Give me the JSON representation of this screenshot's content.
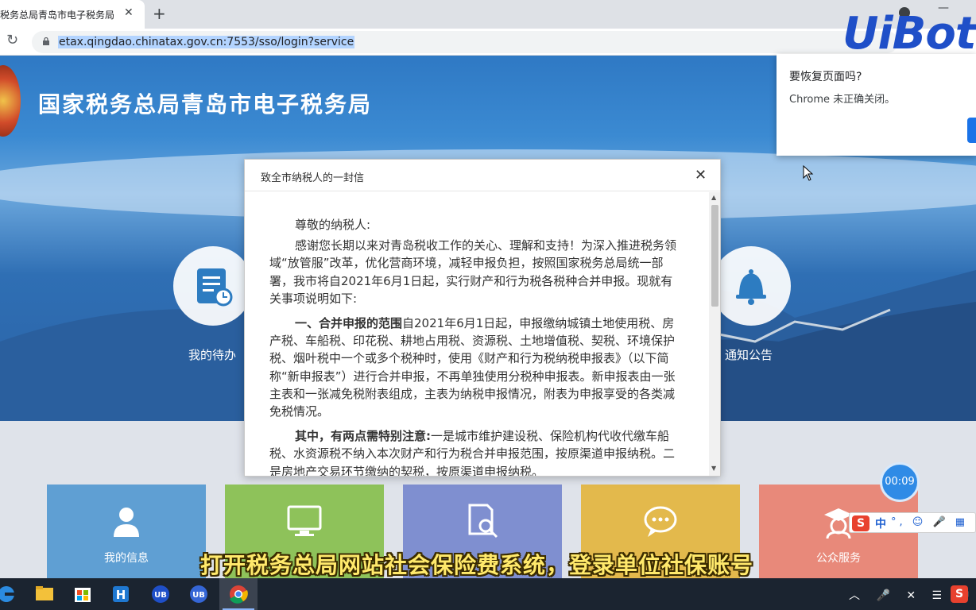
{
  "browser": {
    "tab_title": "税务总局青岛市电子税务局",
    "tab_close": "✕",
    "new_tab": "+",
    "url": "etax.qingdao.chinatax.gov.cn:7553/sso/login?service",
    "reload_icon": "reload-icon",
    "lock_icon": "lock-icon"
  },
  "site": {
    "title": "国家税务总局青岛市电子税务局",
    "quick_links": [
      {
        "label": "我的待办",
        "icon": "todo-icon"
      },
      {
        "label": "通知公告",
        "icon": "bell-icon"
      }
    ],
    "cards": [
      {
        "label": "我的信息",
        "icon": "user-icon",
        "color": "#5f9fd3"
      },
      {
        "label": "",
        "icon": "monitor-icon",
        "color": "#8ec25a"
      },
      {
        "label": "",
        "icon": "search-doc-icon",
        "color": "#7f8fd0"
      },
      {
        "label": "",
        "icon": "chat-icon",
        "color": "#e3b94c"
      },
      {
        "label": "公众服务",
        "icon": "service-icon",
        "color": "#e8897a"
      }
    ]
  },
  "modal": {
    "title": "致全市纳税人的一封信",
    "close": "✕",
    "greeting": "尊敬的纳税人:",
    "para1": "感谢您长期以来对青岛税收工作的关心、理解和支持！为深入推进税务领域“放管服”改革，优化营商环境，减轻申报负担，按照国家税务总局统一部署，我市将自2021年6月1日起，实行财产和行为税各税种合并申报。现就有关事项说明如下:",
    "para2_heading": "一、合并申报的范围",
    "para2": "自2021年6月1日起，申报缴纳城镇土地使用税、房产税、车船税、印花税、耕地占用税、资源税、土地增值税、契税、环境保护税、烟叶税中一个或多个税种时，使用《财产和行为税纳税申报表》（以下简称“新申报表”）进行合并申报，不再单独使用分税种申报表。新申报表由一张主表和一张减免税附表组成，主表为纳税申报情况，附表为申报享受的各类减免税情况。",
    "para3_heading": "其中，有两点需特别注意:",
    "para3": "一是城市维护建设税、保险机构代收代缴车船税、水资源税不纳入本次财产和行为税合并申报范围，按原渠道申报纳税。二是房地产交易环节缴纳的契税，按原渠道申报纳税。"
  },
  "restore_popup": {
    "title": "要恢复页面吗?",
    "message": "Chrome 未正确关闭。"
  },
  "logo": {
    "text": "UiBot"
  },
  "timer": {
    "value": "00:09"
  },
  "ime": {
    "logo": "S",
    "mode": "中",
    "icons": "°, ☺ 🎤 ▦ 👤"
  },
  "subtitle": "打开税务总局网站社会保险费系统，登录单位社保账号",
  "taskbar": {
    "items": [
      "edge-icon",
      "file-explorer-icon",
      "store-icon",
      "h-app-icon",
      "uibot-icon",
      "uibot-creator-icon",
      "chrome-icon"
    ],
    "tray_text": "︿ 🎤 ✕ ☰ 中",
    "tray_s": "S"
  }
}
